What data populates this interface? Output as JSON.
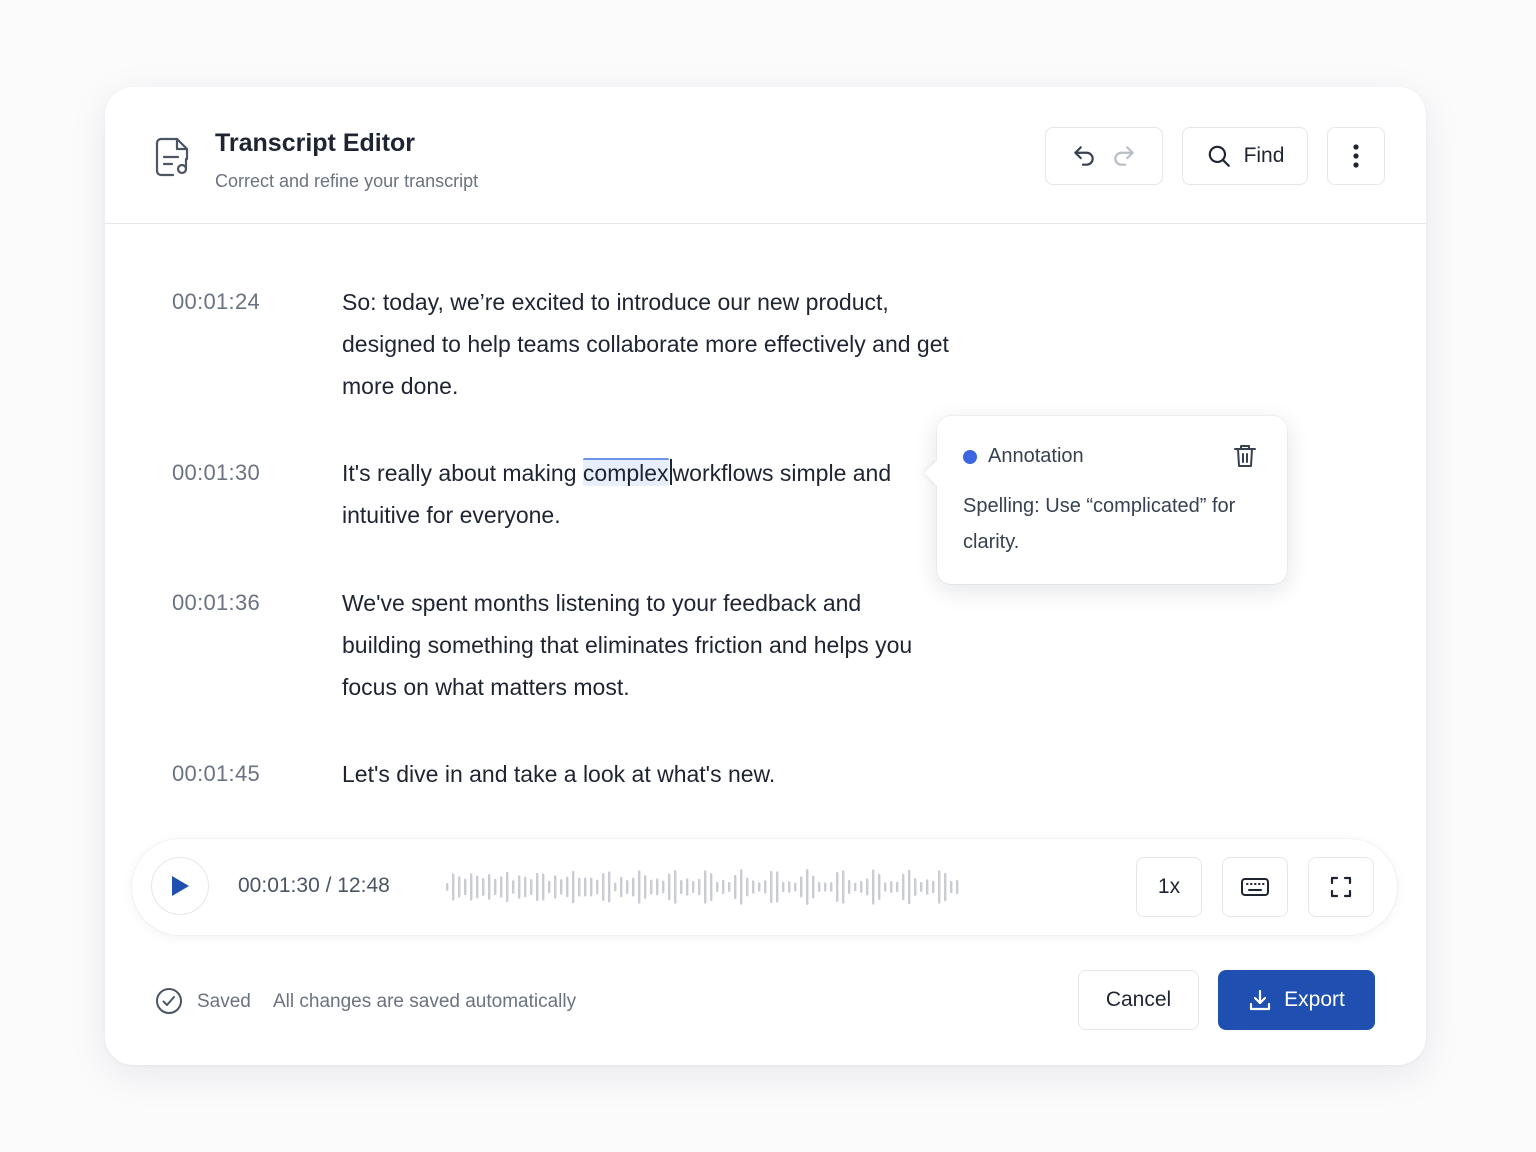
{
  "header": {
    "title": "Transcript Editor",
    "subtitle": "Correct and refine your transcript",
    "find_label": "Find",
    "icons": [
      "document-audio-icon",
      "undo-icon",
      "redo-icon",
      "search-icon",
      "more-vertical-icon"
    ]
  },
  "transcript": [
    {
      "time": "00:01:24",
      "text": "So: today, we’re excited to introduce our new product, designed to help teams collaborate more effectively and get more done."
    },
    {
      "time": "00:01:30",
      "pre": "It's really about making ",
      "highlight": "complex",
      "post": "workflows simple and intuitive for everyone."
    },
    {
      "time": "00:01:36",
      "text": "We've spent months listening to your feedback and building something that eliminates friction and helps you focus on what matters most."
    },
    {
      "time": "00:01:45",
      "text": "Let's dive in and take a look at what's new."
    }
  ],
  "annotation": {
    "title": "Annotation",
    "body": "Spelling: Use “complicated” for clarity.",
    "dot_color": "#3b66e0"
  },
  "player": {
    "time": "00:01:30 / 12:48",
    "speed": "1x"
  },
  "footer": {
    "saved": "Saved",
    "note": "All changes are saved automatically",
    "cancel": "Cancel",
    "export": "Export",
    "accent": "#1f4fb0"
  }
}
